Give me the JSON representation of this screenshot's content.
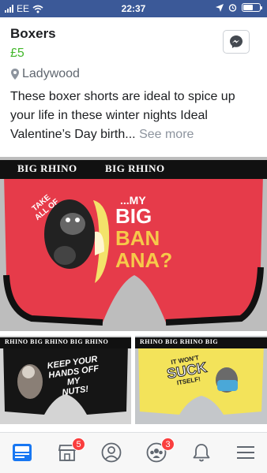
{
  "status_bar": {
    "carrier": "EE",
    "time": "22:37",
    "battery_level": 0.6
  },
  "listing": {
    "title": "Boxers",
    "price": "£5",
    "location": "Ladywood",
    "description": "These boxer shorts are ideal to spice up your life in these winter nights Ideal Valentine’s Day birth...",
    "see_more": "See more"
  },
  "photos": {
    "main": {
      "waistband": [
        "BIG RHINO",
        "BIG RHINO"
      ],
      "take_all_of": [
        "TAKE",
        "ALL OF"
      ],
      "my": "...MY",
      "big": "BIG",
      "ban": "BAN",
      "ana": "ANA?"
    },
    "left": {
      "waistband": "RHINO  BIG RHINO  BIG RHINO",
      "slogan": [
        "KEEP YOUR",
        "HANDS OFF",
        "MY",
        "NUTS!"
      ]
    },
    "right": {
      "waistband": "RHINO  BIG RHINO  BIG",
      "slogan": [
        "IT WON'T",
        "SUCK",
        "ITSELF!"
      ]
    }
  },
  "tabbar": {
    "marketplace_badge": "5",
    "groups_badge": "3"
  },
  "colors": {
    "brand": "#3b5998",
    "price": "#42b72a",
    "badge": "#fa3e3e",
    "active_tab": "#1877f2"
  }
}
